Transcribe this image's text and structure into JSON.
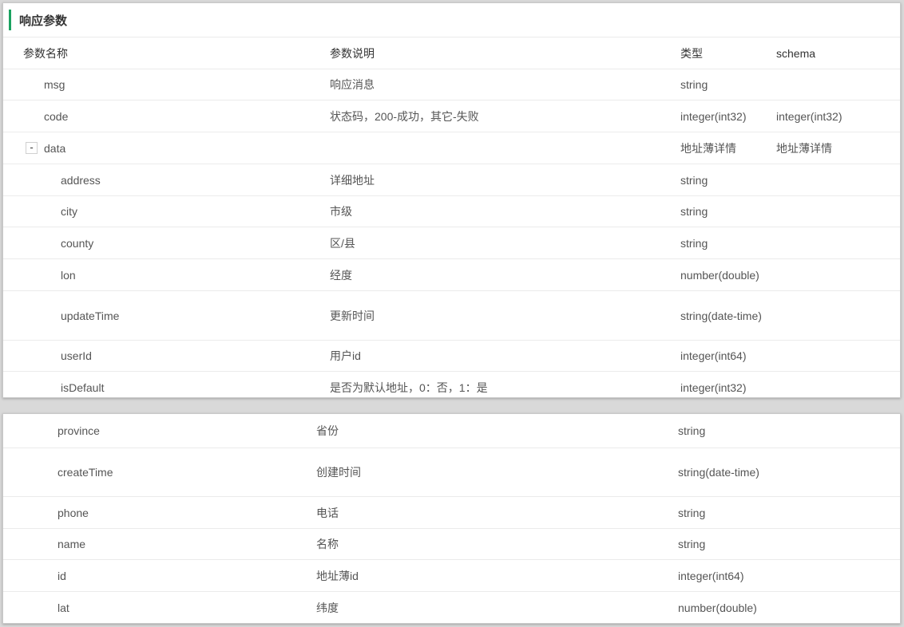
{
  "section": {
    "title": "响应参数"
  },
  "table": {
    "headers": {
      "name": "参数名称",
      "description": "参数说明",
      "type": "类型",
      "schema": "schema"
    },
    "panel1_rows": [
      {
        "name": "msg",
        "description": "响应消息",
        "type": "string",
        "schema": ""
      },
      {
        "name": "code",
        "description": "状态码，200-成功，其它-失败",
        "type": "integer(int32)",
        "schema": "integer(int32)"
      },
      {
        "name": "data",
        "description": "",
        "type": "地址薄详情",
        "schema": "地址薄详情",
        "toggle": "-"
      },
      {
        "name": "address",
        "description": "详细地址",
        "type": "string",
        "schema": ""
      },
      {
        "name": "city",
        "description": "市级",
        "type": "string",
        "schema": ""
      },
      {
        "name": "county",
        "description": "区/县",
        "type": "string",
        "schema": ""
      },
      {
        "name": "lon",
        "description": "经度",
        "type": "number(double)",
        "schema": ""
      },
      {
        "name": "updateTime",
        "description": "更新时间",
        "type": "string(date-time)",
        "schema": ""
      },
      {
        "name": "userId",
        "description": "用户id",
        "type": "integer(int64)",
        "schema": ""
      },
      {
        "name": "isDefault",
        "description": "是否为默认地址，0：否，1：是",
        "type": "integer(int32)",
        "schema": ""
      }
    ],
    "panel2_rows": [
      {
        "name": "province",
        "description": "省份",
        "type": "string"
      },
      {
        "name": "createTime",
        "description": "创建时间",
        "type": "string(date-time)"
      },
      {
        "name": "phone",
        "description": "电话",
        "type": "string"
      },
      {
        "name": "name",
        "description": "名称",
        "type": "string"
      },
      {
        "name": "id",
        "description": "地址薄id",
        "type": "integer(int64)"
      },
      {
        "name": "lat",
        "description": "纬度",
        "type": "number(double)"
      }
    ]
  }
}
